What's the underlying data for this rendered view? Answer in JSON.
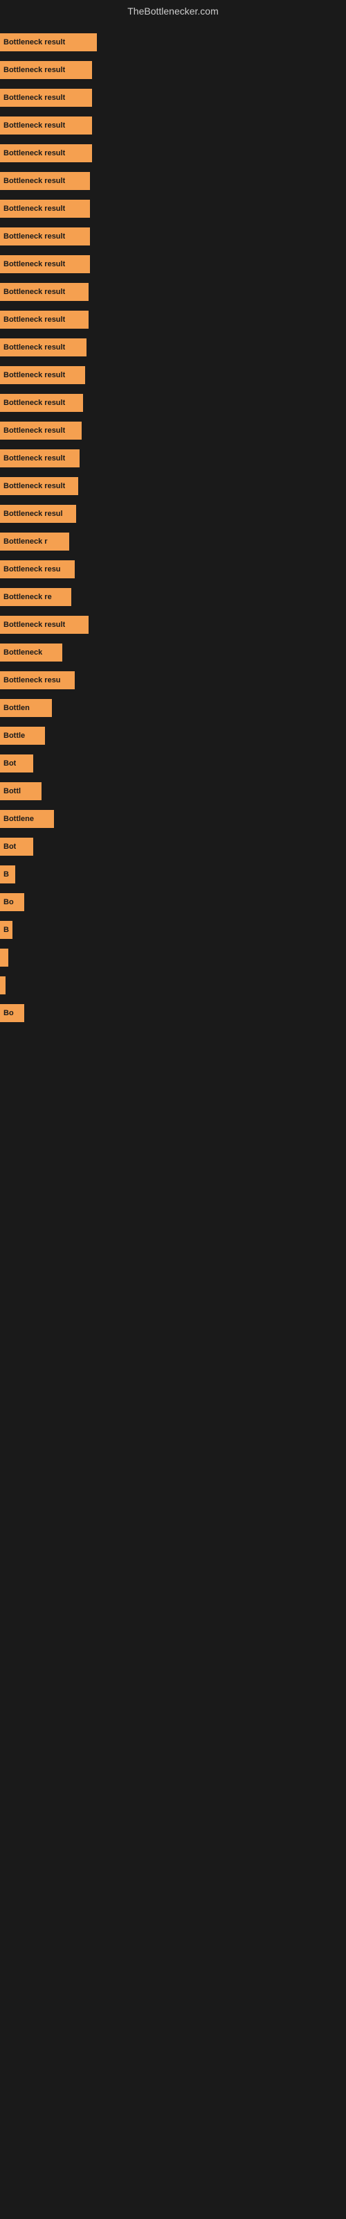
{
  "site": {
    "title": "TheBottlenecker.com"
  },
  "bars": [
    {
      "label": "Bottleneck result",
      "width": 140
    },
    {
      "label": "Bottleneck result",
      "width": 133
    },
    {
      "label": "Bottleneck result",
      "width": 133
    },
    {
      "label": "Bottleneck result",
      "width": 133
    },
    {
      "label": "Bottleneck result",
      "width": 133
    },
    {
      "label": "Bottleneck result",
      "width": 130
    },
    {
      "label": "Bottleneck result",
      "width": 130
    },
    {
      "label": "Bottleneck result",
      "width": 130
    },
    {
      "label": "Bottleneck result",
      "width": 130
    },
    {
      "label": "Bottleneck result",
      "width": 128
    },
    {
      "label": "Bottleneck result",
      "width": 128
    },
    {
      "label": "Bottleneck result",
      "width": 125
    },
    {
      "label": "Bottleneck result",
      "width": 123
    },
    {
      "label": "Bottleneck result",
      "width": 120
    },
    {
      "label": "Bottleneck result",
      "width": 118
    },
    {
      "label": "Bottleneck result",
      "width": 115
    },
    {
      "label": "Bottleneck result",
      "width": 113
    },
    {
      "label": "Bottleneck resul",
      "width": 110
    },
    {
      "label": "Bottleneck r",
      "width": 100
    },
    {
      "label": "Bottleneck resu",
      "width": 108
    },
    {
      "label": "Bottleneck re",
      "width": 103
    },
    {
      "label": "Bottleneck result",
      "width": 128
    },
    {
      "label": "Bottleneck",
      "width": 90
    },
    {
      "label": "Bottleneck resu",
      "width": 108
    },
    {
      "label": "Bottlen",
      "width": 75
    },
    {
      "label": "Bottle",
      "width": 65
    },
    {
      "label": "Bot",
      "width": 48
    },
    {
      "label": "Bottl",
      "width": 60
    },
    {
      "label": "Bottlene",
      "width": 78
    },
    {
      "label": "Bot",
      "width": 48
    },
    {
      "label": "B",
      "width": 22
    },
    {
      "label": "Bo",
      "width": 35
    },
    {
      "label": "B",
      "width": 18
    },
    {
      "label": "",
      "width": 12
    },
    {
      "label": "",
      "width": 8
    },
    {
      "label": "Bo",
      "width": 35
    }
  ]
}
